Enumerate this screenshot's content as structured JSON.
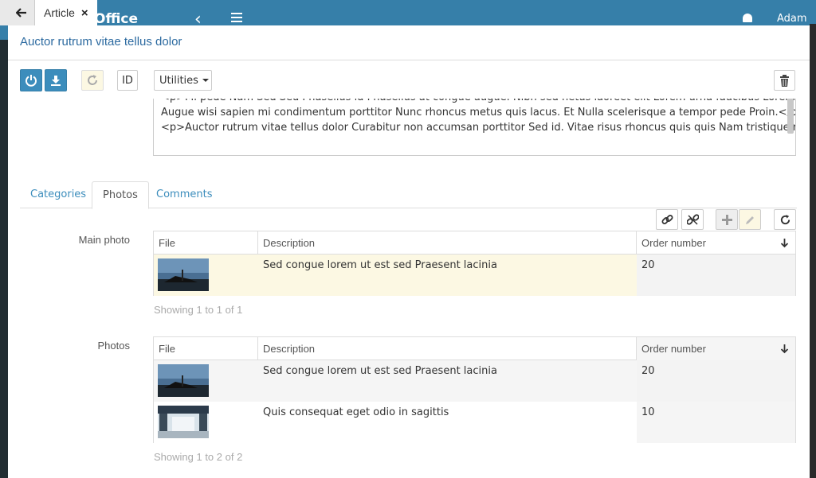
{
  "background": {
    "brand": "Office",
    "user": "Adam"
  },
  "tab": {
    "label": "Article",
    "close": "×"
  },
  "panel": {
    "title": "Auctor rutrum vitae tellus dolor"
  },
  "toolbar": {
    "id_label": "ID",
    "utilities_label": "Utilities"
  },
  "textarea": {
    "lines": [
      "<p>Mi pede Nam Sed Sed Phasellus id Phasellus at congue augue. Nibh sed netus laoreet elit Lorem urna faucibus Lorem justo ipsum.",
      "Augue wisi sapien mi condimentum porttitor Nunc rhoncus metus quis lacus. Et Nulla scelerisque a tempor pede Proin.</p>",
      "<p>Auctor rutrum vitae tellus dolor Curabitur non accumsan porttitor Sed id. Vitae risus rhoncus quis quis Nam tristique non vitae"
    ]
  },
  "tabs": [
    {
      "label": "Categories"
    },
    {
      "label": "Photos"
    },
    {
      "label": "Comments"
    }
  ],
  "main_photo": {
    "label": "Main photo",
    "columns": [
      "File",
      "Description",
      "Order number"
    ],
    "rows": [
      {
        "description": "Sed congue lorem ut est sed Praesent lacinia",
        "order": "20"
      }
    ],
    "showing": "Showing 1 to 1 of 1"
  },
  "photos": {
    "label": "Photos",
    "columns": [
      "File",
      "Description",
      "Order number"
    ],
    "rows": [
      {
        "description": "Sed congue lorem ut est sed Praesent lacinia",
        "order": "20"
      },
      {
        "description": "Quis consequat eget odio in sagittis",
        "order": "10"
      }
    ],
    "showing": "Showing 1 to 2 of 2"
  },
  "colors": {
    "accent": "#3c8dbc",
    "selected_row": "#fcf8e3",
    "topbar": "#367fa9"
  }
}
